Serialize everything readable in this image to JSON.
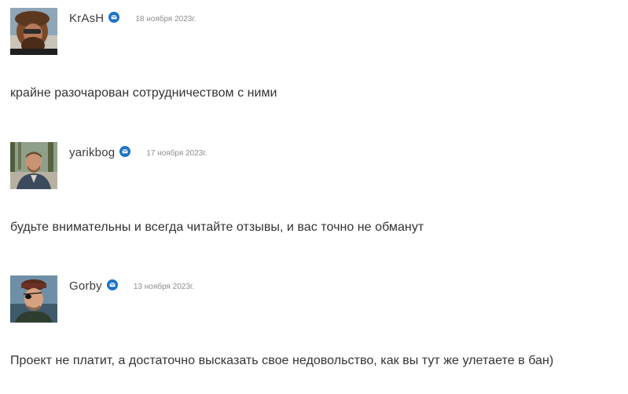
{
  "accent_color": "#1a73c8",
  "comments": [
    {
      "author": "KrAsH",
      "date": "18 ноября 2023г.",
      "text": "крайне разочарован сотрудничеством с ними",
      "avatar_icon": "user-avatar-photo",
      "badge_icon": "verified-badge-icon"
    },
    {
      "author": "yarikbog",
      "date": "17 ноября 2023г.",
      "text": "будьте внимательны и всегда читайте отзывы, и вас точно не обманут",
      "avatar_icon": "user-avatar-photo",
      "badge_icon": "verified-badge-icon"
    },
    {
      "author": "Gorby",
      "date": "13 ноября 2023г.",
      "text": "Проект не платит, а достаточно высказать свое недовольство, как вы тут же улетаете в бан)",
      "avatar_icon": "user-avatar-photo",
      "badge_icon": "verified-badge-icon"
    }
  ]
}
